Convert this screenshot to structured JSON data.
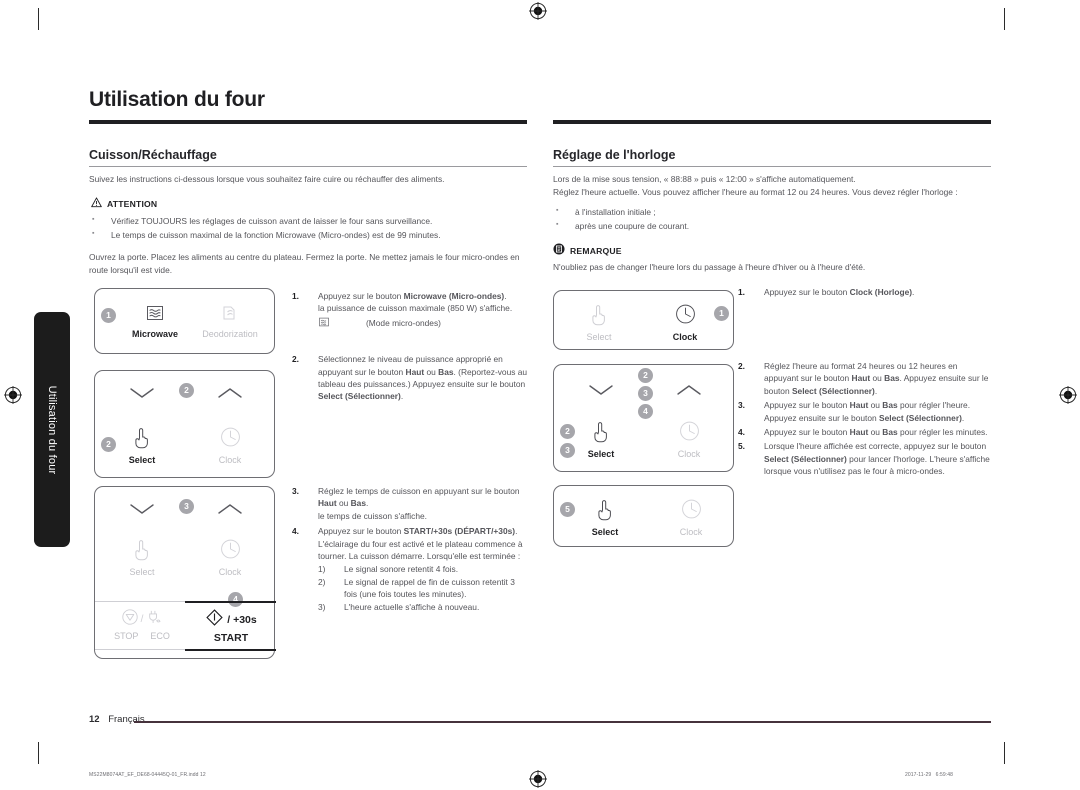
{
  "page": {
    "chapter_title": "Utilisation du four",
    "side_tab_label": "Utilisation du four",
    "folio_number": "12",
    "folio_language": "Français",
    "print_filename": "MS22M8074AT_EF_DE68-04445Q-01_FR.indd   12",
    "print_timestamp": "2017-11-29     6:59:48"
  },
  "left": {
    "heading": "Cuisson/Réchauffage",
    "intro": "Suivez les instructions ci-dessous lorsque vous souhaitez faire cuire ou réchauffer des aliments.",
    "notice_label": "ATTENTION",
    "notice_icon": "warning-triangle-icon",
    "bullets": [
      "Vérifiez TOUJOURS les réglages de cuisson avant de laisser le four sans surveillance.",
      "Le temps de cuisson maximal de la fonction Microwave (Micro-ondes) est de 99 minutes."
    ],
    "paragraph": "Ouvrez la porte. Placez les aliments au centre du plateau. Fermez la porte. Ne mettez jamais le four micro-ondes en route lorsqu'il est vide.",
    "steps": [
      {
        "num": "1.",
        "lines": [
          "Appuyez sur le bouton <b>Microwave (Micro-ondes)</b>.",
          "la puissance de cuisson maximale (850 W) s'affiche."
        ],
        "mode_icon": "microwave-wave-icon",
        "mode_text": "(Mode micro-ondes)"
      },
      {
        "num": "2.",
        "lines": [
          "Sélectionnez le niveau de puissance approprié en appuyant sur le bouton <b>Haut</b> ou <b>Bas</b>. (Reportez-vous au tableau des puissances.) Appuyez ensuite sur le bouton <b>Select (Sélectionner)</b>."
        ]
      },
      {
        "num": "3.",
        "lines": [
          "Réglez le temps de cuisson en appuyant sur le bouton <b>Haut</b> ou <b>Bas</b>.",
          "le temps de cuisson s'affiche."
        ]
      },
      {
        "num": "4.",
        "lines": [
          "Appuyez sur le bouton <b>START/+30s (DÉPART/+30s)</b>. L'éclairage du four est activé et le plateau commence à tourner. La cuisson démarre. Lorsqu'elle est terminée :"
        ],
        "substeps": [
          {
            "num": "1)",
            "text": "Le signal sonore retentit 4 fois."
          },
          {
            "num": "2)",
            "text": "Le signal de rappel de fin de cuisson retentit 3 fois (une fois toutes les minutes)."
          },
          {
            "num": "3)",
            "text": "L'heure actuelle s'affiche à nouveau."
          }
        ]
      }
    ],
    "panels": [
      {
        "name": "panel-microwave",
        "badges": [
          "1"
        ],
        "buttons": [
          {
            "icon": "microwave-wave-icon",
            "label": "Microwave",
            "state": "on"
          },
          {
            "icon": "deodorization-icon",
            "label": "Deodorization",
            "state": "off"
          }
        ]
      },
      {
        "name": "panel-select-clock-step2",
        "badges": [
          "2",
          "2"
        ],
        "buttons": [
          {
            "icon": "chevron-down-icon",
            "label": "",
            "state": "on"
          },
          {
            "icon": "chevron-up-icon",
            "label": "",
            "state": "on"
          },
          {
            "icon": "hand-pointer-icon",
            "label": "Select",
            "state": "on"
          },
          {
            "icon": "clock-icon",
            "label": "Clock",
            "state": "off"
          }
        ]
      },
      {
        "name": "panel-start-step3-4",
        "badges": [
          "3",
          "4"
        ],
        "buttons": [
          {
            "icon": "chevron-down-icon",
            "label": "",
            "state": "on"
          },
          {
            "icon": "chevron-up-icon",
            "label": "",
            "state": "on"
          },
          {
            "icon": "hand-pointer-icon",
            "label": "Select",
            "state": "off"
          },
          {
            "icon": "clock-icon",
            "label": "Clock",
            "state": "off"
          },
          {
            "icon": "stop-icon",
            "label": "STOP",
            "state": "off"
          },
          {
            "icon": "eco-plug-icon",
            "label": "ECO",
            "state": "off"
          },
          {
            "icon": "start-diamond-icon",
            "label": "START",
            "state": "on"
          }
        ],
        "start_plus": "/ +30s"
      }
    ]
  },
  "right": {
    "heading": "Réglage de l'horloge",
    "intro_lines": [
      "Lors de la mise sous tension, « 88:88 » puis « 12:00 » s'affiche automatiquement.",
      "Réglez l'heure actuelle. Vous pouvez afficher l'heure au format 12 ou 24 heures. Vous devez régler l'horloge :"
    ],
    "bullets": [
      "à l'installation initiale ;",
      "après une coupure de courant."
    ],
    "notice_label": "REMARQUE",
    "notice_icon": "note-document-icon",
    "note_text": "N'oubliez pas de changer l'heure lors du passage à l'heure d'hiver ou à l'heure d'été.",
    "steps": [
      {
        "num": "1.",
        "lines": [
          "Appuyez sur le bouton <b>Clock (Horloge)</b>."
        ]
      },
      {
        "num": "2.",
        "lines": [
          "Réglez l'heure au format 24 heures ou 12 heures en appuyant sur le bouton <b>Haut</b> ou <b>Bas</b>. Appuyez ensuite sur le bouton <b>Select (Sélectionner)</b>."
        ]
      },
      {
        "num": "3.",
        "lines": [
          "Appuyez sur le bouton <b>Haut</b> ou <b>Bas</b> pour régler l'heure. Appuyez ensuite sur le bouton <b>Select (Sélectionner)</b>."
        ]
      },
      {
        "num": "4.",
        "lines": [
          "Appuyez sur le bouton <b>Haut</b> ou <b>Bas</b> pour régler les minutes."
        ]
      },
      {
        "num": "5.",
        "lines": [
          "Lorsque l'heure affichée est correcte, appuyez sur le bouton <b>Select (Sélectionner)</b> pour lancer l'horloge. L'heure s'affiche lorsque vous n'utilisez pas le four à micro-ondes."
        ]
      }
    ],
    "panels": [
      {
        "name": "panel-clock-step1",
        "badges": [
          "1"
        ],
        "buttons": [
          {
            "icon": "hand-pointer-icon",
            "label": "Select",
            "state": "off"
          },
          {
            "icon": "clock-icon",
            "label": "Clock",
            "state": "on"
          }
        ]
      },
      {
        "name": "panel-updown-step2-4",
        "badges": [
          "2",
          "3",
          "4",
          "2",
          "3"
        ],
        "buttons": [
          {
            "icon": "chevron-down-icon",
            "label": "",
            "state": "on"
          },
          {
            "icon": "chevron-up-icon",
            "label": "",
            "state": "on"
          },
          {
            "icon": "hand-pointer-icon",
            "label": "Select",
            "state": "on"
          },
          {
            "icon": "clock-icon",
            "label": "Clock",
            "state": "off"
          }
        ]
      },
      {
        "name": "panel-select-step5",
        "badges": [
          "5"
        ],
        "buttons": [
          {
            "icon": "hand-pointer-icon",
            "label": "Select",
            "state": "on"
          },
          {
            "icon": "clock-icon",
            "label": "Clock",
            "state": "off"
          }
        ]
      }
    ]
  },
  "colors": {
    "text_body": "#55555a",
    "text_strong": "#1f1f22",
    "disabled": "#bdbdc2",
    "badge_bg": "#a6a6ab",
    "rule": "#9a9a9e",
    "folio_rule": "#46323c",
    "tab_bg": "#1c1c1c"
  }
}
